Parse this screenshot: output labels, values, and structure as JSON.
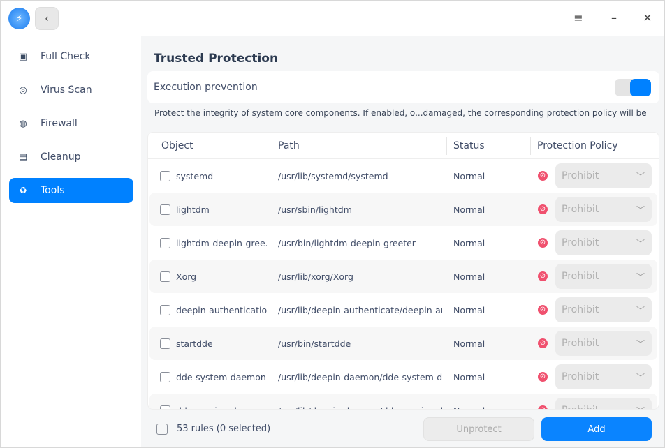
{
  "titlebar": {
    "menu_icon": "hamburger-icon",
    "minimize_icon": "minimize-icon",
    "close_icon": "close-icon"
  },
  "sidebar": {
    "items": [
      {
        "label": "Full Check",
        "icon": "monitor-pulse-icon"
      },
      {
        "label": "Virus Scan",
        "icon": "scan-icon"
      },
      {
        "label": "Firewall",
        "icon": "globe-shield-icon"
      },
      {
        "label": "Cleanup",
        "icon": "cleanup-icon"
      },
      {
        "label": "Tools",
        "icon": "trash-icon",
        "active": true
      }
    ]
  },
  "main": {
    "title": "Trusted Protection",
    "execution_label": "Execution prevention",
    "execution_enabled": true,
    "description": "Protect the integrity of system core components. If enabled, o...damaged, the corresponding protection policy will be executed",
    "columns": [
      "Object",
      "Path",
      "Status",
      "Protection Policy"
    ],
    "rows": [
      {
        "object": "systemd",
        "path": "/usr/lib/systemd/systemd",
        "status": "Normal",
        "policy": "Prohibit"
      },
      {
        "object": "lightdm",
        "path": "/usr/sbin/lightdm",
        "status": "Normal",
        "policy": "Prohibit"
      },
      {
        "object": "lightdm-deepin-gree...",
        "path": "/usr/bin/lightdm-deepin-greeter",
        "status": "Normal",
        "policy": "Prohibit"
      },
      {
        "object": "Xorg",
        "path": "/usr/lib/xorg/Xorg",
        "status": "Normal",
        "policy": "Prohibit"
      },
      {
        "object": "deepin-authentication",
        "path": "/usr/lib/deepin-authenticate/deepin-au...",
        "status": "Normal",
        "policy": "Prohibit"
      },
      {
        "object": "startdde",
        "path": "/usr/bin/startdde",
        "status": "Normal",
        "policy": "Prohibit"
      },
      {
        "object": "dde-system-daemon",
        "path": "/usr/lib/deepin-daemon/dde-system-da...",
        "status": "Normal",
        "policy": "Prohibit"
      },
      {
        "object": "dde-session-daemon",
        "path": "/usr/lib/deepin-daemon/dde-session-d...",
        "status": "Normal",
        "policy": "Prohibit"
      }
    ],
    "footer": {
      "count": "53 rules (0 selected)",
      "unprotect": "Unprotect",
      "add": "Add"
    }
  }
}
